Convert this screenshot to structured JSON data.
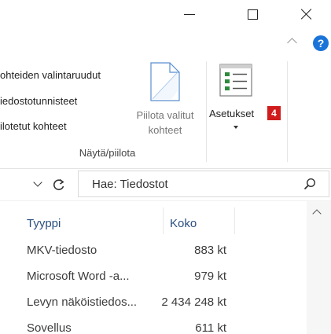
{
  "ribbon": {
    "show_hide": {
      "items": [
        "ohteiden valintaruudut",
        "iedostotunnisteet",
        "ilotetut kohteet"
      ],
      "group_label": "Näytä/piilota"
    },
    "hide_selected": {
      "label_line1": "Piilota valitut",
      "label_line2": "kohteet",
      "icon": "hide-selected-document-icon"
    },
    "settings": {
      "label": "Asetukset",
      "badge": "4",
      "icon": "settings-list-icon"
    }
  },
  "help_glyph": "?",
  "search": {
    "text": "Hae: Tiedostot"
  },
  "columns": {
    "type": "Tyyppi",
    "size": "Koko"
  },
  "rows": [
    {
      "type": "MKV-tiedosto",
      "size": "883 kt"
    },
    {
      "type": "Microsoft Word -a...",
      "size": "979 kt"
    },
    {
      "type": "Levyn näköistiedos...",
      "size": "2 434 248 kt"
    },
    {
      "type": "Sovellus",
      "size": "611 kt"
    }
  ],
  "colors": {
    "accent_blue": "#1a74d8",
    "badge_red": "#d01c1c",
    "header_text": "#2b4f80"
  }
}
